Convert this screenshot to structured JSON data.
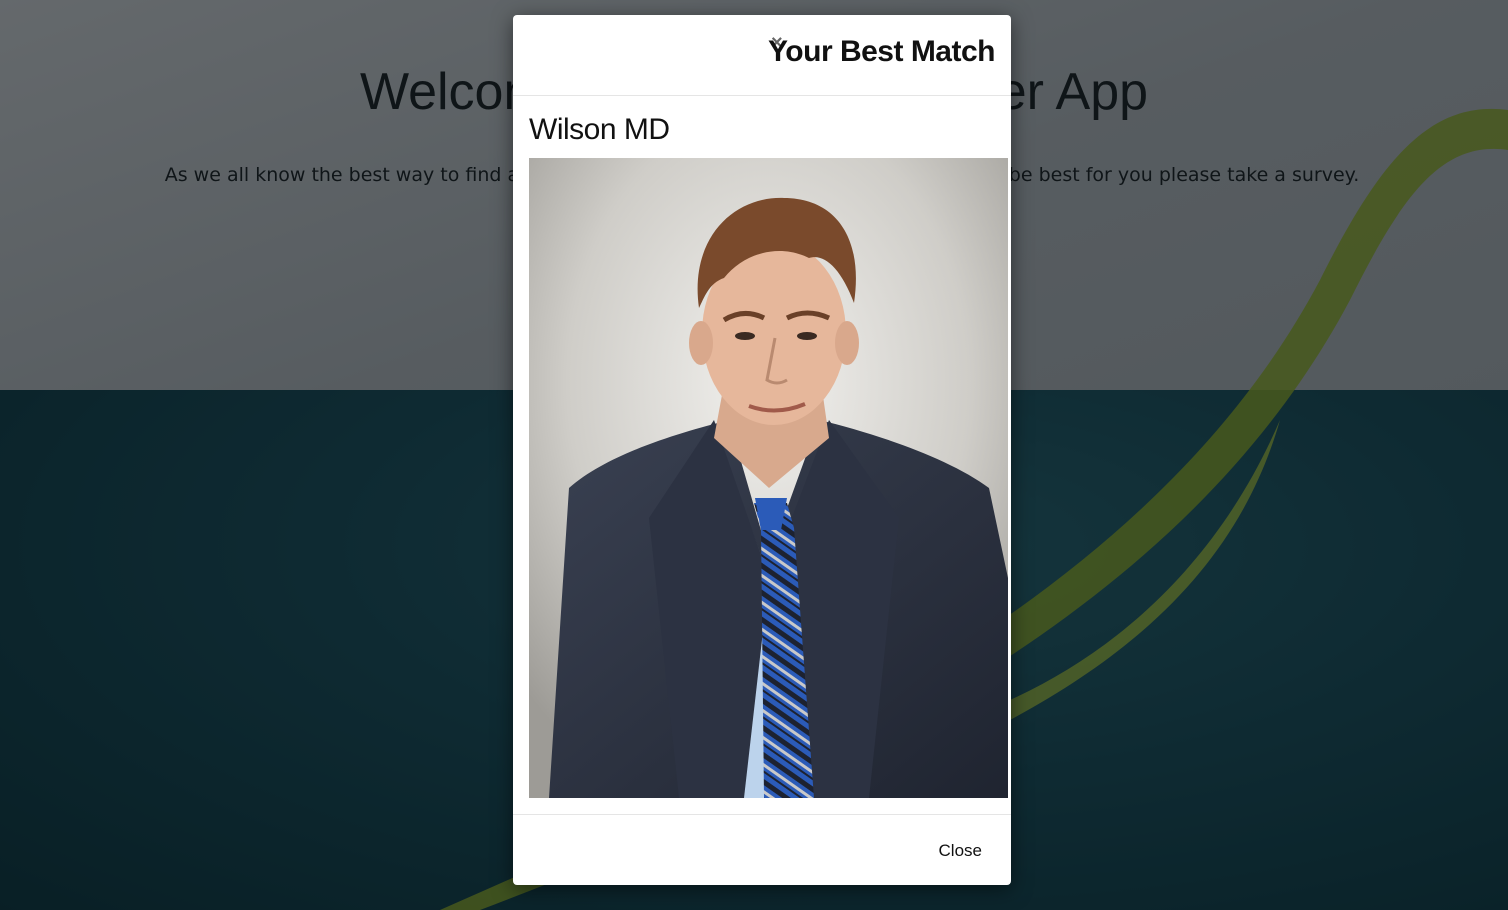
{
  "page": {
    "heading": "Welcome to the Friend Finder App",
    "intro": "As we all know the best way to find a new friend is to take a survey! To find out who will be best for you please take a survey."
  },
  "modal": {
    "title": "Your Best Match",
    "close_symbol": "×",
    "match_name": "Wilson MD",
    "photo_alt": "Wilson MD",
    "close_label": "Close"
  },
  "colors": {
    "backdrop": "rgba(0,0,0,0.5)",
    "swoosh": "#8fb23a",
    "suit": "#2c3242",
    "shirt": "#bcd3ec",
    "tie": "#2b5bb8"
  },
  "icons": {
    "close": "close-icon"
  }
}
